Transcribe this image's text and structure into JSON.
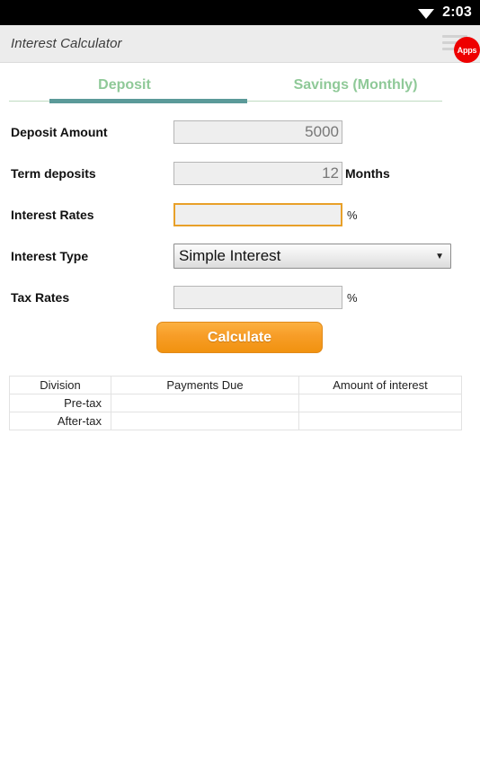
{
  "status_bar": {
    "wifi_icon": "wifi-icon",
    "time": "2:03"
  },
  "app_bar": {
    "title": "Interest Calculator",
    "menu_icon": "hamburger-menu-icon",
    "apps_badge_label": "Apps"
  },
  "tabs": [
    {
      "label": "Deposit",
      "active": true
    },
    {
      "label": "Savings (Monthly)",
      "active": false
    }
  ],
  "form": {
    "deposit_amount": {
      "label": "Deposit Amount",
      "value": "5000"
    },
    "term_deposits": {
      "label": "Term deposits",
      "value": "12",
      "suffix": "Months"
    },
    "interest_rates": {
      "label": "Interest Rates",
      "value": "",
      "suffix": "%"
    },
    "interest_type": {
      "label": "Interest Type",
      "value": "Simple Interest",
      "arrow_icon": "chevron-down-icon"
    },
    "tax_rates": {
      "label": "Tax Rates",
      "value": "",
      "suffix": "%"
    },
    "calculate_label": "Calculate"
  },
  "results": {
    "headers": [
      "Division",
      "Payments Due",
      "Amount of interest"
    ],
    "rows": [
      {
        "division": "Pre-tax",
        "payments_due": "",
        "amount_of_interest": ""
      },
      {
        "division": "After-tax",
        "payments_due": "",
        "amount_of_interest": ""
      }
    ]
  },
  "colors": {
    "status_bar_bg": "#000000",
    "app_bar_bg": "#ececec",
    "tab_text": "#8fc998",
    "tab_underline": "#5b9a99",
    "accent_orange": "#f5a01f",
    "focus_border": "#e8a029",
    "badge_red": "#ee0000"
  }
}
